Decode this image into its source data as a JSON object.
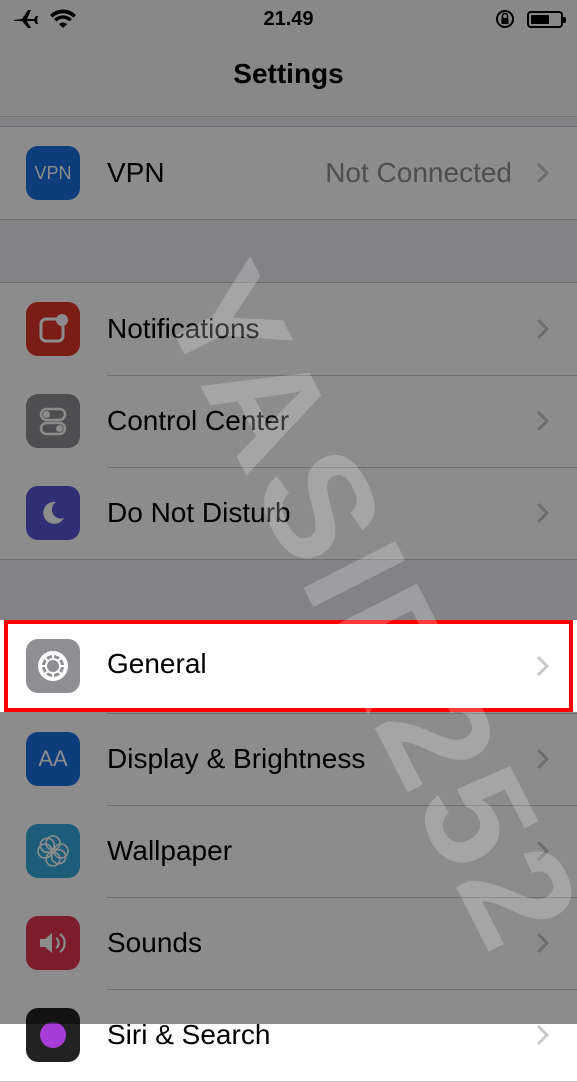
{
  "status_bar": {
    "time": "21.49"
  },
  "nav": {
    "title": "Settings"
  },
  "groups": [
    {
      "items": [
        {
          "label": "VPN",
          "detail": "Not Connected",
          "icon_name": "vpn-icon",
          "icon_text": "VPN",
          "color": "#1a6fe0"
        }
      ]
    },
    {
      "items": [
        {
          "label": "Notifications",
          "icon_name": "notifications-icon",
          "color": "#e0352b"
        },
        {
          "label": "Control Center",
          "icon_name": "control-center-icon",
          "color": "#8e8e93"
        },
        {
          "label": "Do Not Disturb",
          "icon_name": "moon-icon",
          "color": "#5856d6"
        }
      ]
    },
    {
      "items": [
        {
          "label": "General",
          "icon_name": "gear-icon",
          "color": "#8e8e93"
        },
        {
          "label": "Display & Brightness",
          "icon_name": "display-brightness-icon",
          "icon_text": "AA",
          "color": "#1a6fe0"
        },
        {
          "label": "Wallpaper",
          "icon_name": "wallpaper-icon",
          "color": "#35aadc"
        },
        {
          "label": "Sounds",
          "icon_name": "speaker-icon",
          "color": "#e0354f"
        },
        {
          "label": "Siri & Search",
          "icon_name": "siri-icon",
          "color": "#222"
        }
      ]
    }
  ],
  "watermark": "YASIR252"
}
